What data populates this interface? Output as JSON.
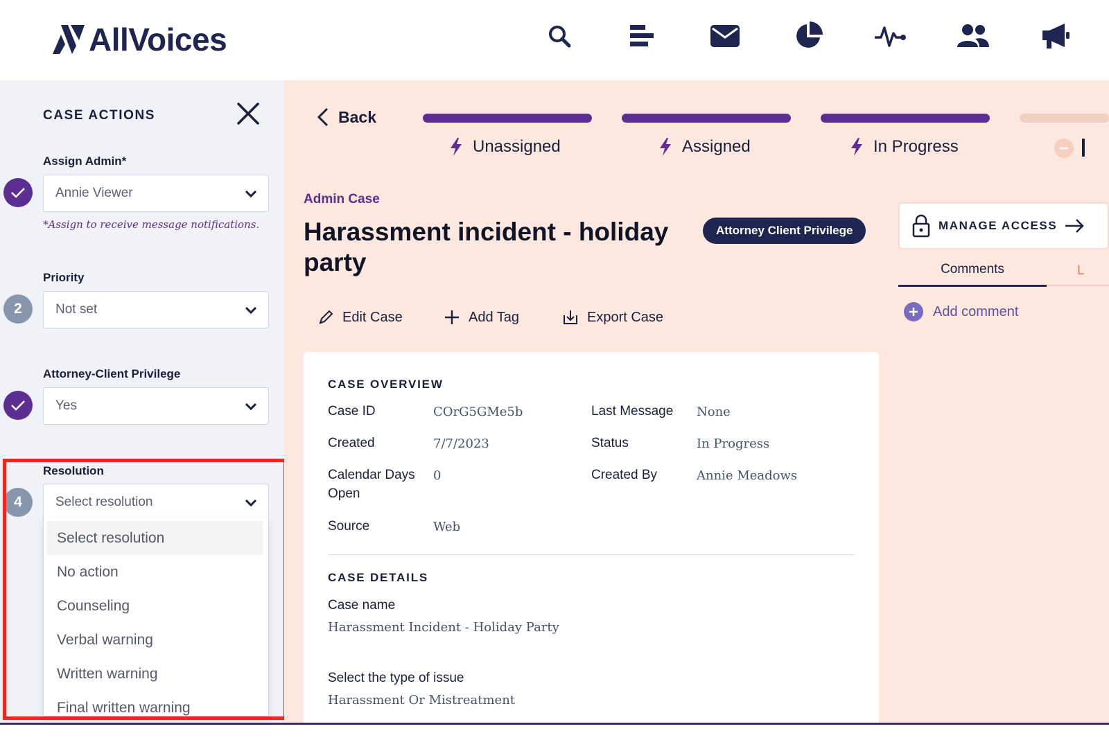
{
  "header": {
    "logo_text": "AllVoices",
    "nav_icons": [
      "search-icon",
      "list-icon",
      "mail-icon",
      "pie-chart-icon",
      "activity-icon",
      "users-icon",
      "megaphone-icon"
    ]
  },
  "sidebar": {
    "title": "CASE ACTIONS",
    "assign_admin": {
      "label": "Assign Admin*",
      "value": "Annie Viewer",
      "hint": "*Assign to receive message notifications."
    },
    "priority": {
      "label": "Priority",
      "step": "2",
      "value": "Not set"
    },
    "privilege": {
      "label": "Attorney-Client Privilege",
      "value": "Yes"
    },
    "resolution": {
      "label": "Resolution",
      "step": "4",
      "placeholder": "Select resolution",
      "options": [
        "Select resolution",
        "No action",
        "Counseling",
        "Verbal warning",
        "Written warning",
        "Final written warning"
      ]
    }
  },
  "progress": {
    "back_label": "Back",
    "stages": [
      "Unassigned",
      "Assigned",
      "In Progress"
    ]
  },
  "case": {
    "type_label": "Admin Case",
    "title": "Harassment incident - holiday party",
    "badge": "Attorney Client Privilege",
    "actions": {
      "edit": "Edit Case",
      "tag": "Add Tag",
      "export": "Export Case"
    },
    "overview": {
      "title": "CASE OVERVIEW",
      "case_id_label": "Case ID",
      "case_id": "COrG5GMe5b",
      "created_label": "Created",
      "created": "7/7/2023",
      "days_open_label": "Calendar Days Open",
      "days_open": "0",
      "source_label": "Source",
      "source": "Web",
      "last_message_label": "Last Message",
      "last_message": "None",
      "status_label": "Status",
      "status": "In Progress",
      "created_by_label": "Created By",
      "created_by": "Annie Meadows"
    },
    "details": {
      "title": "CASE DETAILS",
      "case_name_label": "Case name",
      "case_name": "Harassment Incident - Holiday Party",
      "issue_type_label": "Select the type of issue",
      "issue_type": "Harassment Or Mistreatment"
    }
  },
  "right_panel": {
    "manage_access": "MANAGE ACCESS",
    "tab_comments": "Comments",
    "tab_other": "L",
    "add_comment": "Add comment"
  },
  "colors": {
    "brand_navy": "#1e2550",
    "brand_purple": "#5c2e91",
    "main_bg": "#fde8df",
    "sidebar_bg": "#f0f2f8",
    "highlight_red": "#f0271a"
  }
}
